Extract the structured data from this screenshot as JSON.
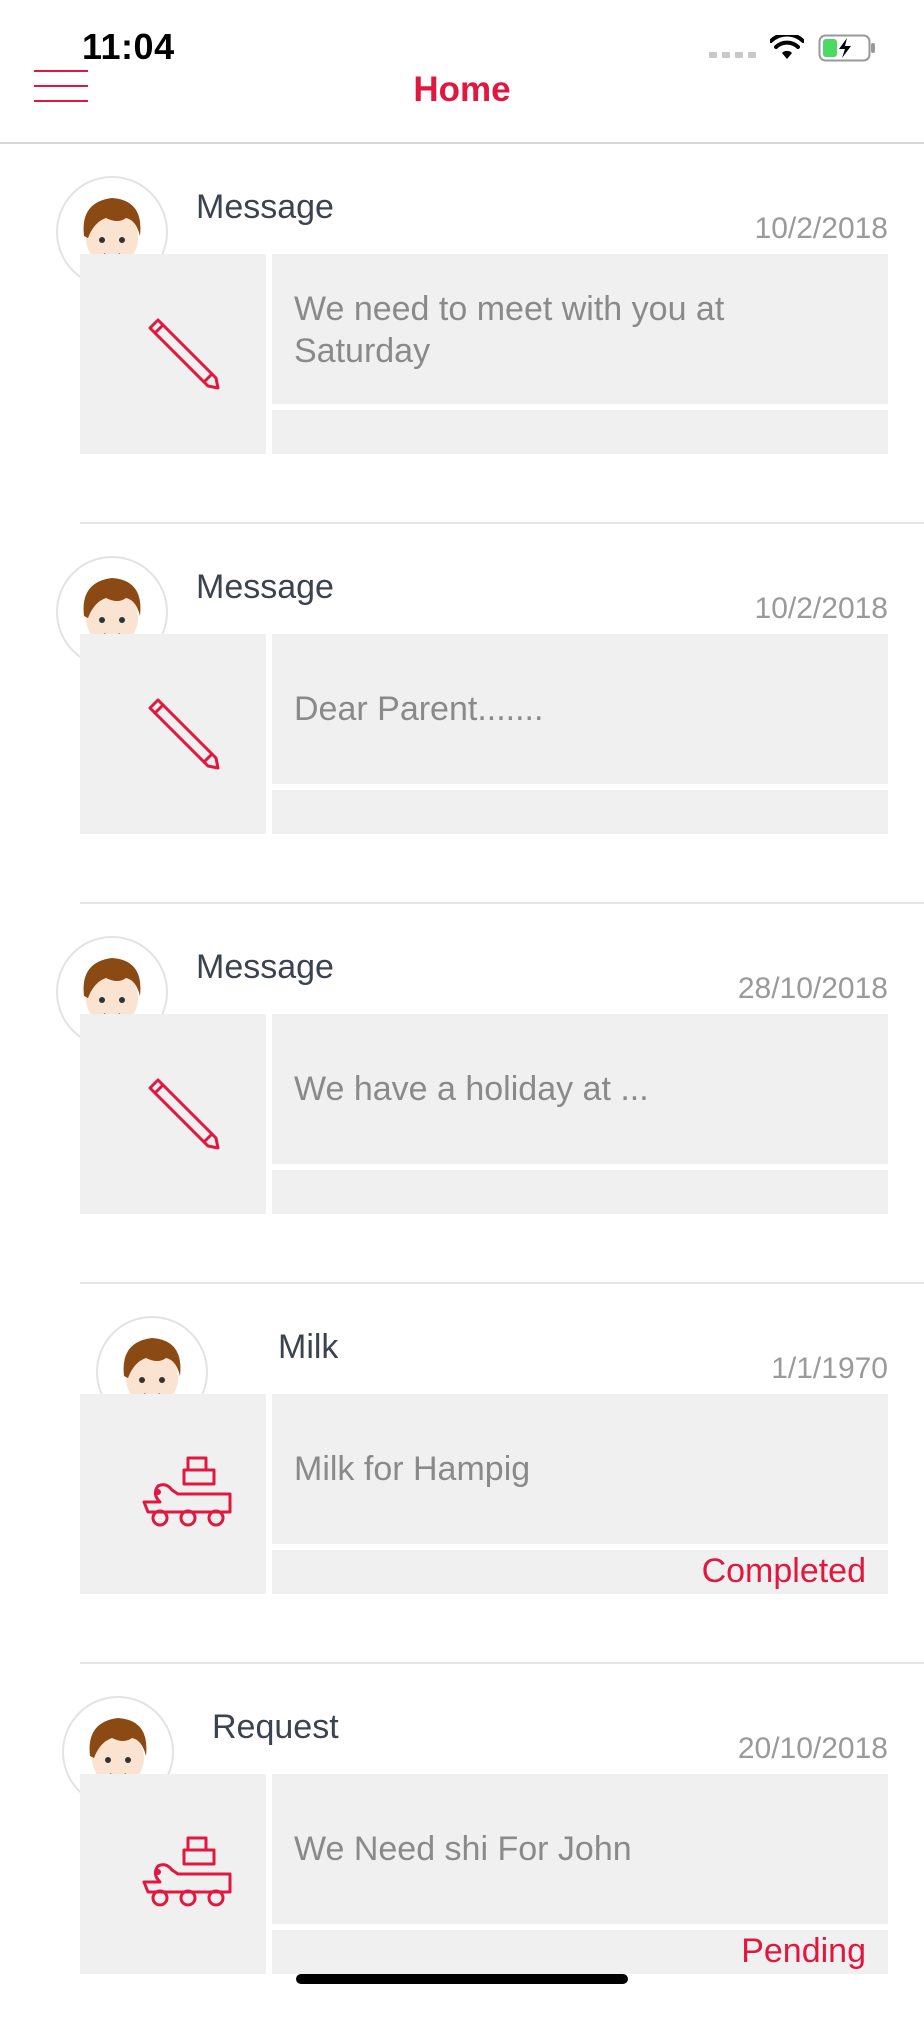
{
  "status_bar": {
    "time": "11:04"
  },
  "header": {
    "title": "Home"
  },
  "colors": {
    "accent": "#e0173f",
    "panel": "#f0f0f0",
    "muted_text": "#8a8a8a",
    "title_text": "#3b4250"
  },
  "cards": [
    {
      "title": "Message",
      "date": "10/2/2018",
      "text": "We need to meet with you at Saturday",
      "status": "",
      "icon": "pencil-icon"
    },
    {
      "title": "Message",
      "date": "10/2/2018",
      "text": "Dear Parent.......",
      "status": "",
      "icon": "pencil-icon"
    },
    {
      "title": "Message",
      "date": "28/10/2018",
      "text": "We have a holiday at ...",
      "status": "",
      "icon": "pencil-icon"
    },
    {
      "title": "Milk",
      "date": "1/1/1970",
      "text": "Milk for Hampig",
      "status": "Completed",
      "icon": "toy-train-icon"
    },
    {
      "title": "Request",
      "date": "20/10/2018",
      "text": "We Need shi For John",
      "status": "Pending",
      "icon": "toy-train-icon"
    }
  ]
}
